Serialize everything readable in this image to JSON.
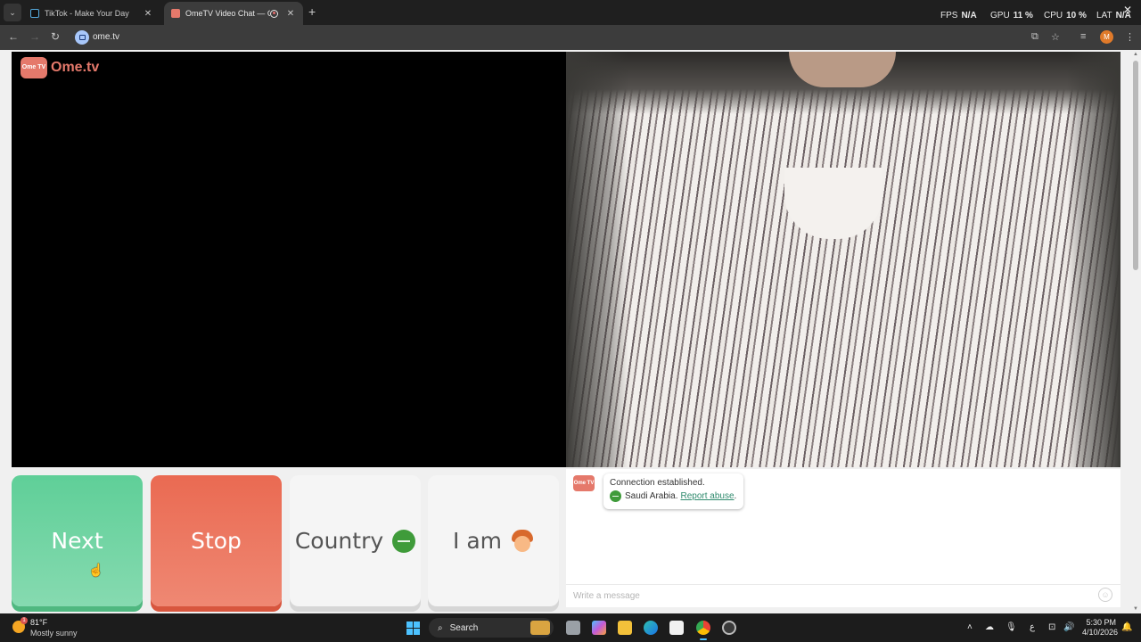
{
  "browser": {
    "tabs": [
      {
        "title": "TikTok - Make Your Day",
        "active": false
      },
      {
        "title": "OmeTV Video Chat — Ome",
        "active": true
      }
    ],
    "address": "ome.tv",
    "profile_initial": "M",
    "perf": [
      {
        "key": "FPS",
        "value": "N/A"
      },
      {
        "key": "GPU",
        "value": "11 %"
      },
      {
        "key": "CPU",
        "value": "10 %"
      },
      {
        "key": "LAT",
        "value": "N/A"
      }
    ]
  },
  "site": {
    "logo_badge": "Ome TV",
    "logo_text": "Ome.tv"
  },
  "buttons": {
    "next": "Next",
    "stop": "Stop",
    "country": "Country",
    "iam": "I am"
  },
  "chat": {
    "logo_badge": "Ome TV",
    "status": "Connection established.",
    "country": "Saudi Arabia.",
    "report": "Report abuse",
    "report_suffix": ".",
    "placeholder": "Write a message"
  },
  "taskbar": {
    "temperature": "81°F",
    "weather": "Mostly sunny",
    "weather_badge": "1",
    "search": "Search",
    "time": "5:30 PM",
    "date": "4/10/2026"
  },
  "colors": {
    "next": "#5fcf98",
    "stop": "#ea6a52",
    "brand": "#e5796b",
    "report_link": "#2f8a6d"
  }
}
